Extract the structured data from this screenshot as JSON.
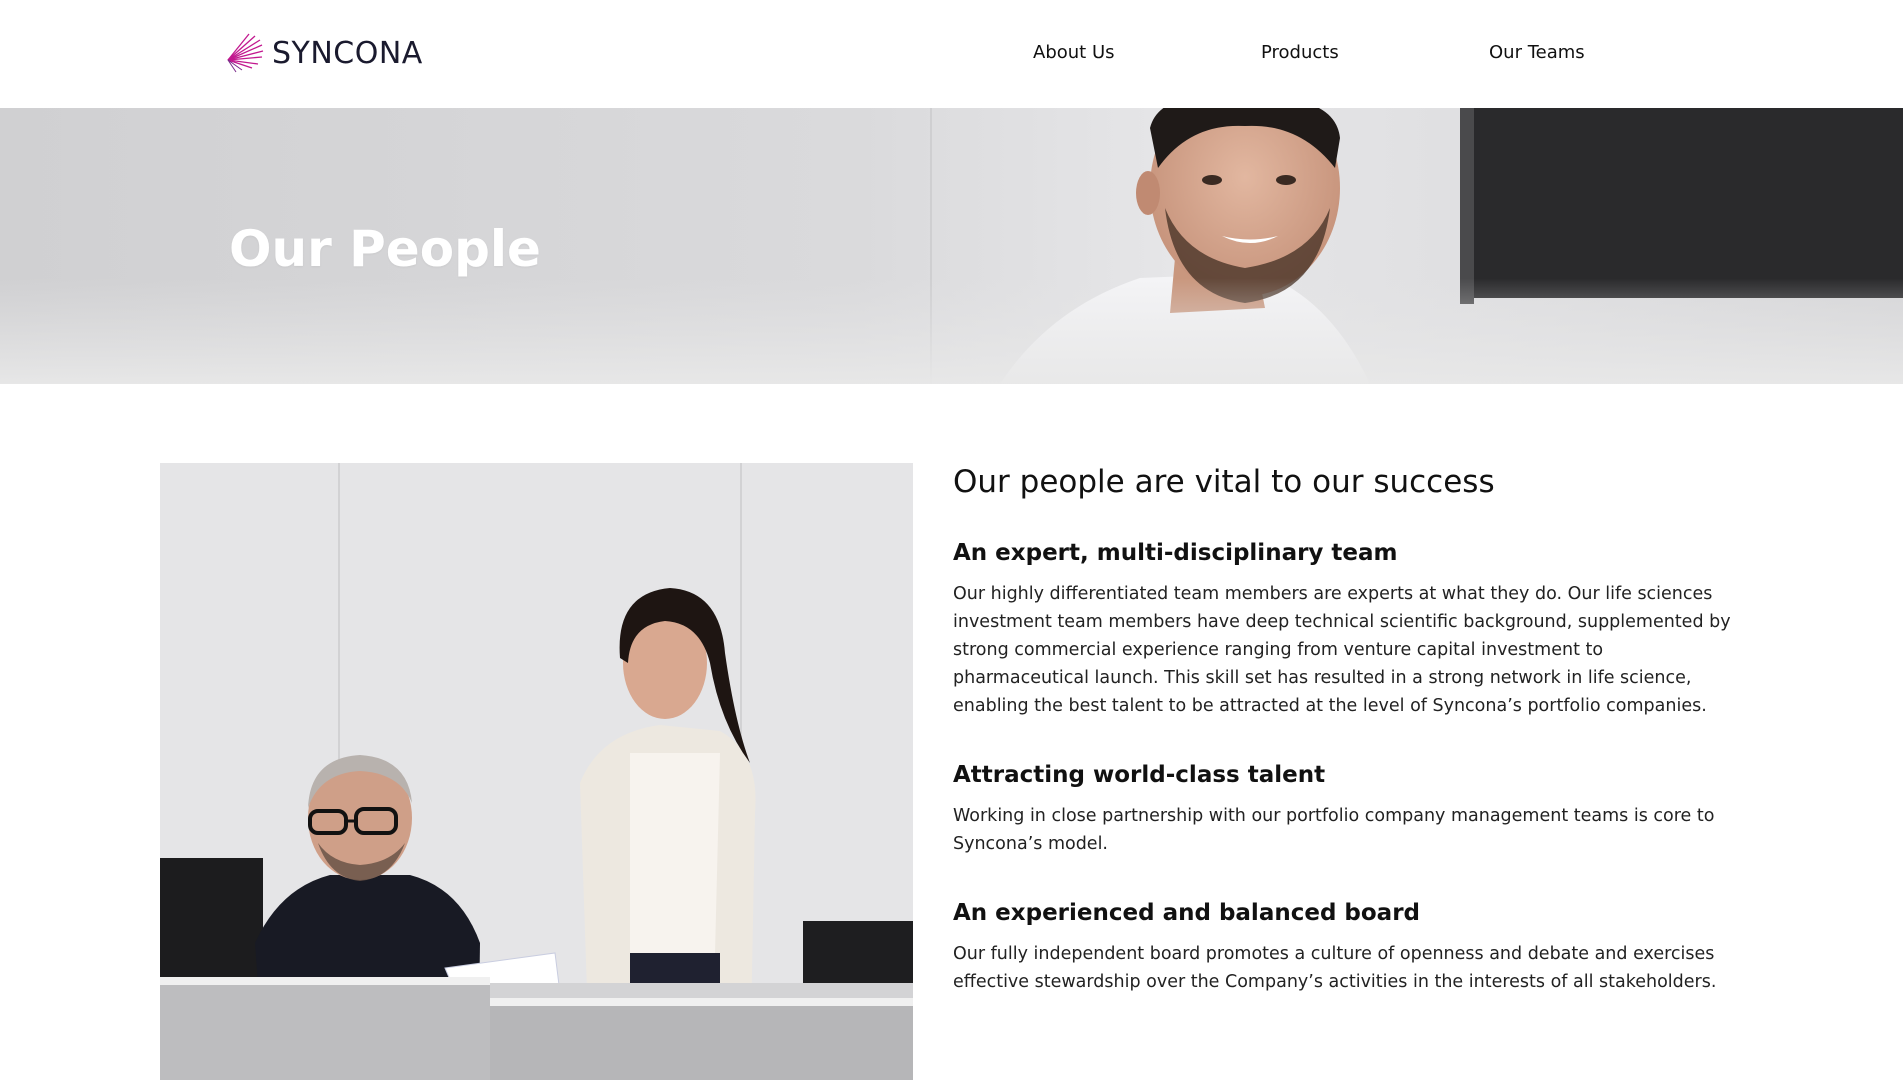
{
  "brand": {
    "name": "SYNCONA",
    "accent": "#c2188f"
  },
  "nav": {
    "items": [
      {
        "label": "About Us"
      },
      {
        "label": "Products"
      },
      {
        "label": "Our Teams"
      }
    ]
  },
  "hero": {
    "title": "Our People"
  },
  "content": {
    "heading": "Our people are vital to our success",
    "sections": [
      {
        "title": "An expert, multi-disciplinary team",
        "body": "Our highly differentiated team members are experts at what they do. Our life sciences investment team members have deep technical scientific background, supplemented by strong commercial experience ranging from venture capital investment to pharmaceutical launch. This skill set has resulted in a strong network in life science, enabling the best talent to be attracted at the level of Syncona’s portfolio companies."
      },
      {
        "title": "Attracting world-class talent",
        "body": "Working in close partnership with our portfolio company management teams is core to Syncona’s model."
      },
      {
        "title": "An experienced and balanced board",
        "body": "Our fully independent board promotes a culture of openness and debate and exercises effective stewardship over the Company’s activities in the interests of all stakeholders."
      }
    ]
  }
}
